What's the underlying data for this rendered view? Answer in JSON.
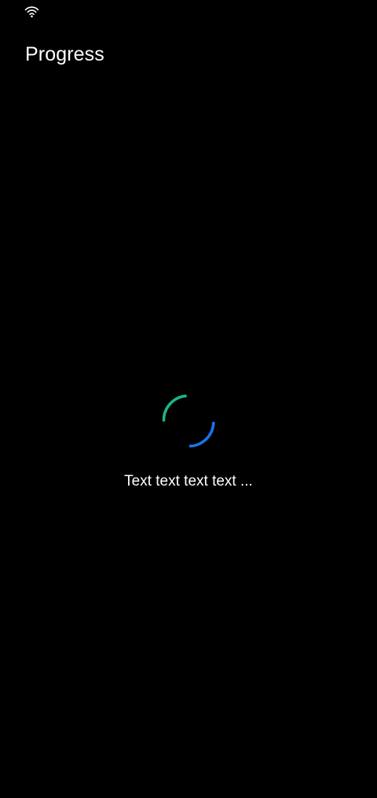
{
  "status_bar": {
    "wifi_icon": "wifi-icon"
  },
  "header": {
    "title": "Progress"
  },
  "progress": {
    "message": "Text text text text ...",
    "spinner_icon": "spinner-icon",
    "colors": {
      "arc_start": "#1bb58a",
      "arc_end": "#1a73e8",
      "background": "#000000",
      "text": "#ffffff"
    }
  }
}
